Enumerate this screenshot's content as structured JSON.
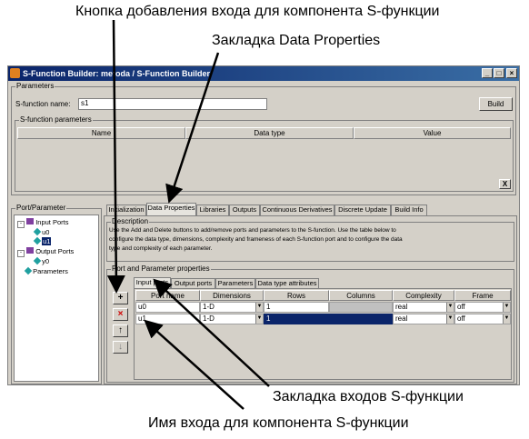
{
  "annotations": {
    "add_input_button": "Кнопка добавления входа для компонента S-функции",
    "data_properties_tab": "Закладка Data Properties",
    "input_ports_tab": "Закладка входов S-функции",
    "input_name": "Имя входа для компонента S-функции"
  },
  "window": {
    "title": "S-Function Builder: metoda / S-Function Builder",
    "minimize": "_",
    "maximize": "□",
    "close": "×"
  },
  "parameters": {
    "group_label": "Parameters",
    "sfunction_name_label": "S-function name:",
    "sfunction_name_value": "s1",
    "build_label": "Build",
    "params_group_label": "S-function parameters",
    "columns": [
      "Name",
      "Data type",
      "Value"
    ],
    "close_x": "X"
  },
  "port_parameter": {
    "group_label": "Port/Parameter",
    "tree": [
      {
        "label": "Input Ports",
        "icon": "input-ports-icon"
      },
      {
        "label": "u0",
        "icon": "port-icon"
      },
      {
        "label": "u1",
        "icon": "port-icon"
      },
      {
        "label": "Output Ports",
        "icon": "output-ports-icon"
      },
      {
        "label": "y0",
        "icon": "port-icon"
      },
      {
        "label": "Parameters",
        "icon": "parameter-icon"
      }
    ]
  },
  "tabs": [
    "Initialization",
    "Data Properties",
    "Libraries",
    "Outputs",
    "Continuous Derivatives",
    "Discrete Update",
    "Build Info"
  ],
  "description": {
    "label": "Description",
    "text": [
      "Use the Add and Delete buttons to add/remove ports and parameters to the S-function. Use the table below to",
      "configure the data type, dimensions, complexity and frameness of each S-function port and to configure the data",
      "type and complexity of each parameter."
    ]
  },
  "port_props": {
    "label": "Port and Parameter properties",
    "subtabs": [
      "Input ports",
      "Output ports",
      "Parameters",
      "Data type attributes"
    ],
    "columns": [
      "Port name",
      "Dimensions",
      "Rows",
      "Columns",
      "Complexity",
      "Frame"
    ],
    "rows": [
      {
        "name": "u0",
        "dims": "1-D",
        "rows": "1",
        "cols": "",
        "complexity": "real",
        "frame": "off"
      },
      {
        "name": "u1",
        "dims": "1-D",
        "rows": "1",
        "cols": "",
        "complexity": "real",
        "frame": "off"
      }
    ],
    "buttons": {
      "add": "+",
      "delete": "×",
      "up": "↑",
      "down": "↓"
    }
  },
  "colors": {
    "selected_row": "#0a246a",
    "title_start": "#0a246a",
    "delete_red": "#d00000"
  }
}
